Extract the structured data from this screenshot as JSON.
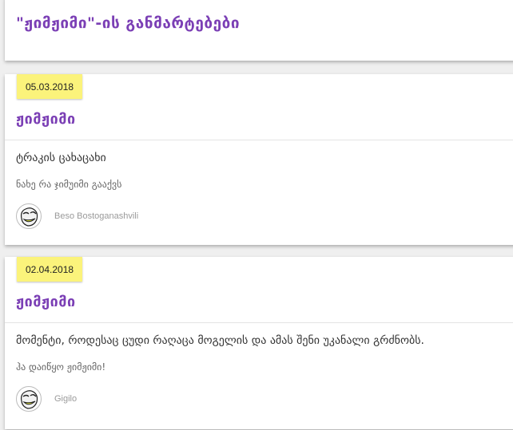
{
  "header": {
    "title": "\"ჟიმჟიმი\"-ის განმარტებები"
  },
  "entries": [
    {
      "date": "05.03.2018",
      "word": "ჟიმჟიმი",
      "definition": "ტრაკის ცახაცახი",
      "example": "ნახე რა ჯიმუიმი გააქვს",
      "author": "Beso Bostoganashvili"
    },
    {
      "date": "02.04.2018",
      "word": "ჟიმჟიმი",
      "definition": "მომენტი, როდესაც ცუდი რაღაცა მოგელის და ამას შენი უკანალი გრძნობს.",
      "example": "ჰა დაიწყო ჟიმჟიმი!",
      "author": "Gigilo"
    }
  ],
  "icons": {
    "avatar": "trollface-avatar-icon"
  },
  "colors": {
    "accent": "#7b3fb5",
    "date_badge": "#fbf37b"
  }
}
